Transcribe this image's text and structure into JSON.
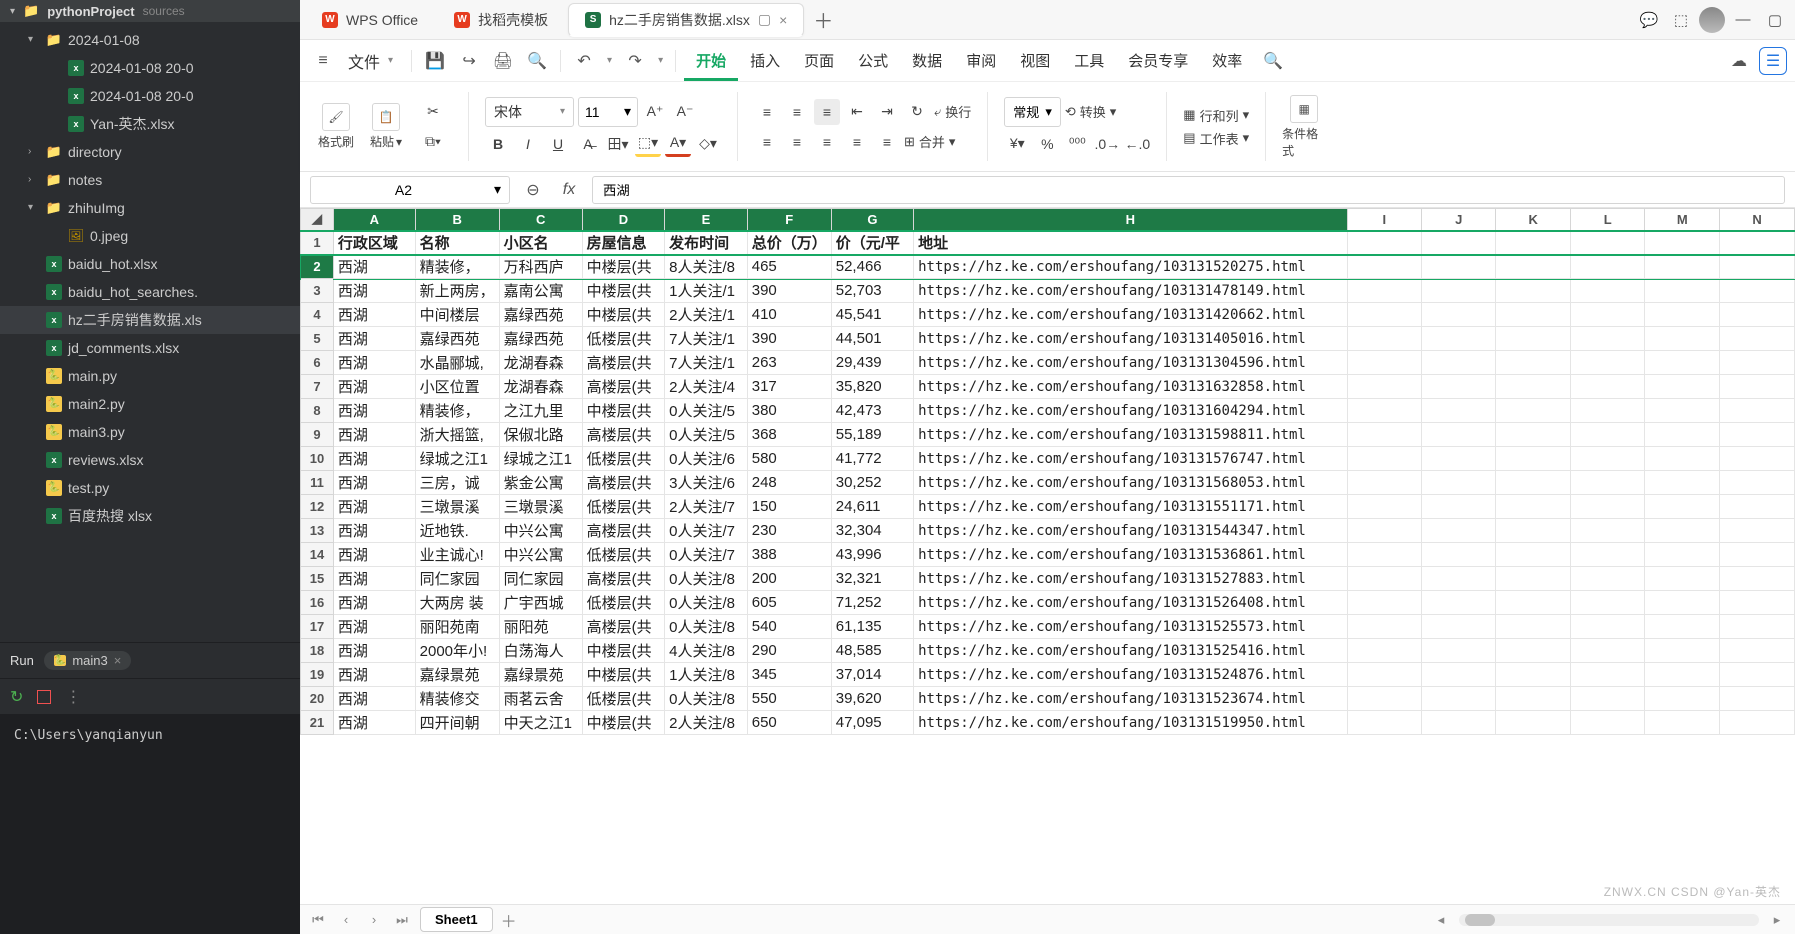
{
  "ide": {
    "project": "pythonProject",
    "project_sub": "sources",
    "tree": [
      {
        "lvl": 1,
        "type": "fold",
        "open": true,
        "label": "2024-01-08"
      },
      {
        "lvl": 2,
        "type": "xl",
        "label": "2024-01-08 20-0"
      },
      {
        "lvl": 2,
        "type": "xl",
        "label": "2024-01-08 20-0"
      },
      {
        "lvl": 2,
        "type": "xl",
        "label": "Yan-英杰.xlsx"
      },
      {
        "lvl": 1,
        "type": "fold",
        "label": "directory"
      },
      {
        "lvl": 1,
        "type": "fold",
        "label": "notes"
      },
      {
        "lvl": 1,
        "type": "fold",
        "open": true,
        "label": "zhihuImg"
      },
      {
        "lvl": 2,
        "type": "img",
        "label": "0.jpeg"
      },
      {
        "lvl": 1,
        "type": "xl",
        "label": "baidu_hot.xlsx"
      },
      {
        "lvl": 1,
        "type": "xl",
        "label": "baidu_hot_searches."
      },
      {
        "lvl": 1,
        "type": "xl",
        "sel": true,
        "label": "hz二手房销售数据.xls"
      },
      {
        "lvl": 1,
        "type": "xl",
        "label": "jd_comments.xlsx"
      },
      {
        "lvl": 1,
        "type": "py",
        "label": "main.py"
      },
      {
        "lvl": 1,
        "type": "py",
        "label": "main2.py"
      },
      {
        "lvl": 1,
        "type": "py",
        "label": "main3.py"
      },
      {
        "lvl": 1,
        "type": "xl",
        "label": "reviews.xlsx"
      },
      {
        "lvl": 1,
        "type": "py",
        "label": "test.py"
      },
      {
        "lvl": 1,
        "type": "xl",
        "label": "百度热搜 xlsx"
      }
    ],
    "run_label": "Run",
    "run_tab": "main3",
    "terminal_output": "C:\\Users\\yanqianyun"
  },
  "tabs": [
    {
      "icon": "wps-logo",
      "label": "WPS Office"
    },
    {
      "icon": "doc-red",
      "label": "找稻壳模板"
    },
    {
      "icon": "sheet",
      "label": "hz二手房销售数据.xlsx",
      "active": true,
      "pin": true,
      "close": true
    }
  ],
  "menubar": {
    "file": "文件",
    "items": [
      "开始",
      "插入",
      "页面",
      "公式",
      "数据",
      "审阅",
      "视图",
      "工具",
      "会员专享",
      "效率"
    ]
  },
  "ribbon": {
    "fmt_brush": "格式刷",
    "paste": "粘贴",
    "font": "宋体",
    "size": "11",
    "wrap": "换行",
    "merge": "合并",
    "numfmt": "常规",
    "convert": "转换",
    "rowcol": "行和列",
    "sheet": "工作表",
    "cond": "条件格式"
  },
  "namebox": "A2",
  "formula": "西湖",
  "cols": [
    "A",
    "B",
    "C",
    "D",
    "E",
    "F",
    "G",
    "H",
    "I",
    "J",
    "K",
    "L",
    "M",
    "N"
  ],
  "selected_col_letters": [
    "A",
    "B",
    "C",
    "D",
    "E",
    "F",
    "G",
    "H"
  ],
  "header": [
    "行政区域",
    "名称",
    "小区名",
    "房屋信息",
    "发布时间",
    "总价（万）",
    "价（元/平",
    "地址"
  ],
  "rows": [
    {
      "n": 2,
      "a": "西湖",
      "b": "精装修，",
      "c": "万科西庐",
      "d": "中楼层(共",
      "e": "8人关注/8",
      "f": "465",
      "g": "52,466",
      "h": "https://hz.ke.com/ershoufang/103131520275.html"
    },
    {
      "n": 3,
      "a": "西湖",
      "b": "新上两房，",
      "c": "嘉南公寓",
      "d": "中楼层(共",
      "e": "1人关注/1",
      "f": "390",
      "g": "52,703",
      "h": "https://hz.ke.com/ershoufang/103131478149.html"
    },
    {
      "n": 4,
      "a": "西湖",
      "b": "中间楼层",
      "c": "嘉绿西苑",
      "d": "中楼层(共",
      "e": "2人关注/1",
      "f": "410",
      "g": "45,541",
      "h": "https://hz.ke.com/ershoufang/103131420662.html"
    },
    {
      "n": 5,
      "a": "西湖",
      "b": "嘉绿西苑",
      "c": "嘉绿西苑",
      "d": "低楼层(共",
      "e": "7人关注/1",
      "f": "390",
      "g": "44,501",
      "h": "https://hz.ke.com/ershoufang/103131405016.html"
    },
    {
      "n": 6,
      "a": "西湖",
      "b": "水晶郦城,",
      "c": "龙湖春森",
      "d": "高楼层(共",
      "e": "7人关注/1",
      "f": "263",
      "g": "29,439",
      "h": "https://hz.ke.com/ershoufang/103131304596.html"
    },
    {
      "n": 7,
      "a": "西湖",
      "b": "小区位置",
      "c": "龙湖春森",
      "d": "高楼层(共",
      "e": "2人关注/4",
      "f": "317",
      "g": "35,820",
      "h": "https://hz.ke.com/ershoufang/103131632858.html"
    },
    {
      "n": 8,
      "a": "西湖",
      "b": "精装修，",
      "c": "之江九里",
      "d": "中楼层(共",
      "e": "0人关注/5",
      "f": "380",
      "g": "42,473",
      "h": "https://hz.ke.com/ershoufang/103131604294.html"
    },
    {
      "n": 9,
      "a": "西湖",
      "b": "浙大摇篮,",
      "c": "保俶北路",
      "d": "高楼层(共",
      "e": "0人关注/5",
      "f": "368",
      "g": "55,189",
      "h": "https://hz.ke.com/ershoufang/103131598811.html"
    },
    {
      "n": 10,
      "a": "西湖",
      "b": "绿城之江1",
      "c": "绿城之江1",
      "d": "低楼层(共",
      "e": "0人关注/6",
      "f": "580",
      "g": "41,772",
      "h": "https://hz.ke.com/ershoufang/103131576747.html"
    },
    {
      "n": 11,
      "a": "西湖",
      "b": "三房，诚",
      "c": "紫金公寓",
      "d": "高楼层(共",
      "e": "3人关注/6",
      "f": "248",
      "g": "30,252",
      "h": "https://hz.ke.com/ershoufang/103131568053.html"
    },
    {
      "n": 12,
      "a": "西湖",
      "b": "三墩景溪",
      "c": "三墩景溪",
      "d": "低楼层(共",
      "e": "2人关注/7",
      "f": "150",
      "g": "24,611",
      "h": "https://hz.ke.com/ershoufang/103131551171.html"
    },
    {
      "n": 13,
      "a": "西湖",
      "b": "近地铁.",
      "c": "中兴公寓",
      "d": "高楼层(共",
      "e": "0人关注/7",
      "f": "230",
      "g": "32,304",
      "h": "https://hz.ke.com/ershoufang/103131544347.html"
    },
    {
      "n": 14,
      "a": "西湖",
      "b": "业主诚心!",
      "c": "中兴公寓",
      "d": "低楼层(共",
      "e": "0人关注/7",
      "f": "388",
      "g": "43,996",
      "h": "https://hz.ke.com/ershoufang/103131536861.html"
    },
    {
      "n": 15,
      "a": "西湖",
      "b": "同仁家园",
      "c": "同仁家园",
      "d": "高楼层(共",
      "e": "0人关注/8",
      "f": "200",
      "g": "32,321",
      "h": "https://hz.ke.com/ershoufang/103131527883.html"
    },
    {
      "n": 16,
      "a": "西湖",
      "b": "大两房 装",
      "c": "广宇西城",
      "d": "低楼层(共",
      "e": "0人关注/8",
      "f": "605",
      "g": "71,252",
      "h": "https://hz.ke.com/ershoufang/103131526408.html"
    },
    {
      "n": 17,
      "a": "西湖",
      "b": "丽阳苑南",
      "c": "丽阳苑",
      "d": "高楼层(共",
      "e": "0人关注/8",
      "f": "540",
      "g": "61,135",
      "h": "https://hz.ke.com/ershoufang/103131525573.html"
    },
    {
      "n": 18,
      "a": "西湖",
      "b": "2000年小!",
      "c": "白荡海人",
      "d": "中楼层(共",
      "e": "4人关注/8",
      "f": "290",
      "g": "48,585",
      "h": "https://hz.ke.com/ershoufang/103131525416.html"
    },
    {
      "n": 19,
      "a": "西湖",
      "b": "嘉绿景苑",
      "c": "嘉绿景苑",
      "d": "中楼层(共",
      "e": "1人关注/8",
      "f": "345",
      "g": "37,014",
      "h": "https://hz.ke.com/ershoufang/103131524876.html"
    },
    {
      "n": 20,
      "a": "西湖",
      "b": "精装修交",
      "c": "雨茗云舍",
      "d": "低楼层(共",
      "e": "0人关注/8",
      "f": "550",
      "g": "39,620",
      "h": "https://hz.ke.com/ershoufang/103131523674.html"
    },
    {
      "n": 21,
      "a": "西湖",
      "b": "四开间朝",
      "c": "中天之江1",
      "d": "中楼层(共",
      "e": "2人关注/8",
      "f": "650",
      "g": "47,095",
      "h": "https://hz.ke.com/ershoufang/103131519950.html"
    }
  ],
  "sheet_tab": "Sheet1",
  "watermark": "ZNWX.CN  CSDN @Yan-英杰"
}
